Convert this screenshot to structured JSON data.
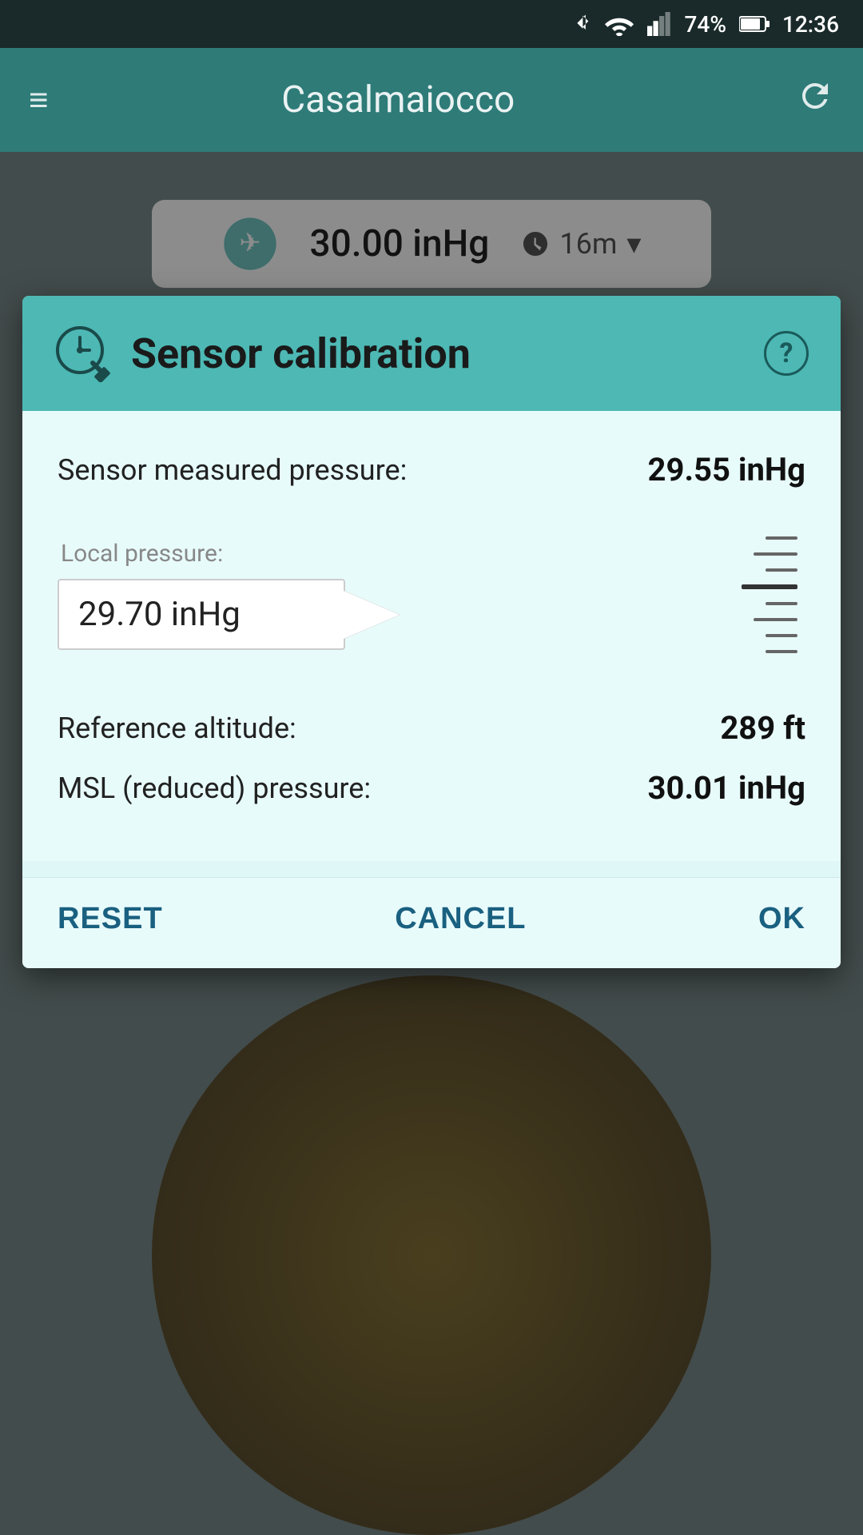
{
  "statusBar": {
    "battery": "74%",
    "time": "12:36"
  },
  "appBar": {
    "title": "Casalmaiocco",
    "menuIcon": "≡",
    "refreshIcon": "↻"
  },
  "bgCard": {
    "value": "30.00 inHg",
    "timeValue": "16m",
    "chevron": "▾"
  },
  "dialog": {
    "title": "Sensor calibration",
    "helpIcon": "?",
    "sensorPressureLabel": "Sensor measured pressure:",
    "sensorPressureValue": "29.55 inHg",
    "localPressureLabel": "Local pressure:",
    "localPressureValue": "29.70 inHg",
    "referenceAltitudeLabel": "Reference altitude:",
    "referenceAltitudeValue": "289 ft",
    "mslPressureLabel": "MSL (reduced) pressure:",
    "mslPressureValue": "30.01 inHg",
    "buttons": {
      "reset": "RESET",
      "cancel": "CANCEL",
      "ok": "OK"
    }
  }
}
